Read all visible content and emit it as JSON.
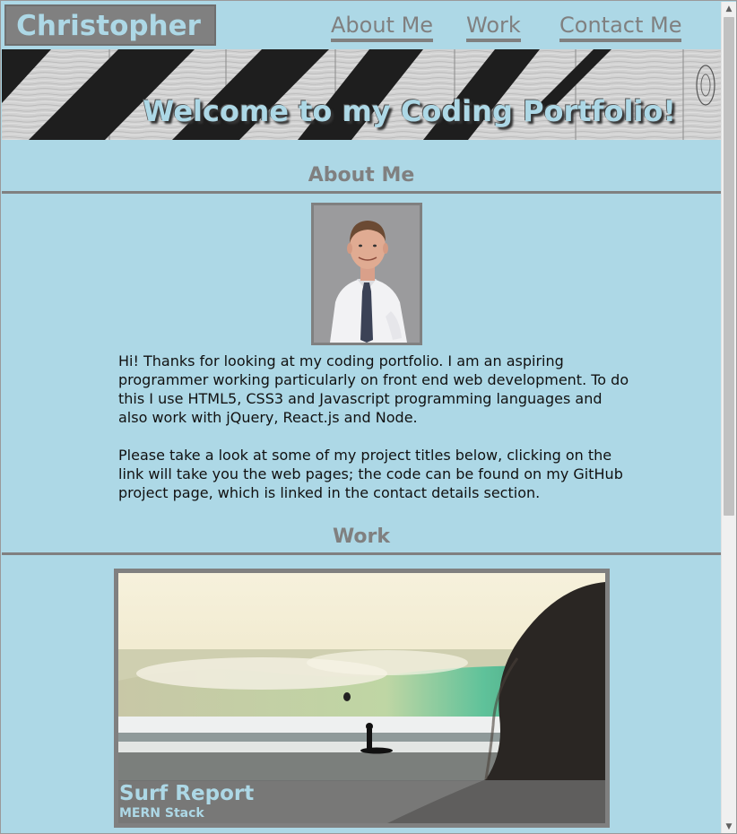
{
  "header": {
    "brand": "Christopher",
    "nav": {
      "about": "About Me",
      "work": "Work",
      "contact": "Contact Me"
    }
  },
  "hero": {
    "title": "Welcome to my Coding Portfolio!"
  },
  "about": {
    "heading": "About Me",
    "photo_icon": "profile-photo",
    "paragraphs": [
      "Hi! Thanks for looking at my coding portfolio. I am an aspiring programmer working particularly on front end web development. To do this I use HTML5, CSS3 and Javascript programming languages and also work with jQuery, React.js and Node.",
      "Please take a look at some of my project titles below, clicking on the link will take you the web pages; the code can be found on my GitHub project page, which is linked in the contact details section."
    ]
  },
  "work": {
    "heading": "Work",
    "projects": [
      {
        "title": "Surf Report",
        "stack": "MERN Stack"
      }
    ]
  },
  "colors": {
    "background": "#add8e6",
    "accent": "#808080"
  },
  "scrollbar": {
    "up_icon": "scroll-up-arrow-icon",
    "down_icon": "scroll-down-arrow-icon"
  }
}
